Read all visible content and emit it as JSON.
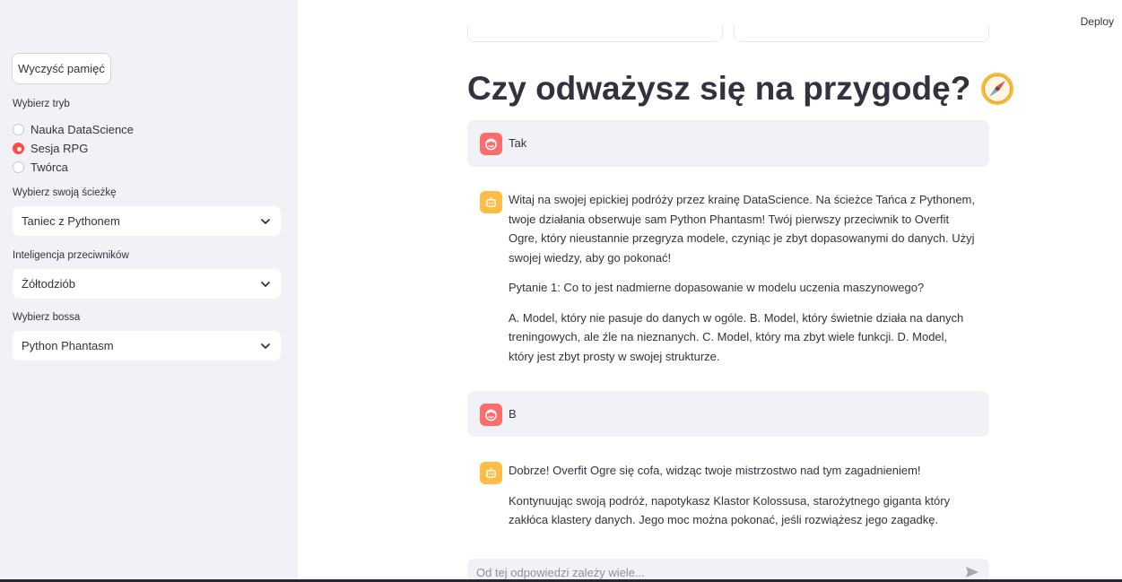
{
  "sidebar": {
    "clear_button": "Wyczyść pamięć",
    "mode_label": "Wybierz tryb",
    "modes": [
      {
        "label": "Nauka DataScience",
        "checked": false
      },
      {
        "label": "Sesja RPG",
        "checked": true
      },
      {
        "label": "Twórca",
        "checked": false
      }
    ],
    "path_label": "Wybierz swoją ścieżkę",
    "path_value": "Taniec z Pythonem",
    "intel_label": "Inteligencja przeciwników",
    "intel_value": "Żółtodziób",
    "boss_label": "Wybierz bossa",
    "boss_value": "Python Phantasm"
  },
  "header": {
    "deploy": "Deploy"
  },
  "main": {
    "title": "Czy odważysz się na przygodę?",
    "messages": [
      {
        "role": "user",
        "text": "Tak"
      },
      {
        "role": "assistant",
        "paragraphs": [
          "Witaj na swojej epickiej podróży przez krainę DataScience. Na ścieżce Tańca z Pythonem, twoje działania obserwuje sam Python Phantasm! Twój pierwszy przeciwnik to Overfit Ogre, który nieustannie przegryza modele, czyniąc je zbyt dopasowanymi do danych. Użyj swojej wiedzy, aby go pokonać!",
          "Pytanie 1: Co to jest nadmierne dopasowanie w modelu uczenia maszynowego?",
          "A. Model, który nie pasuje do danych w ogóle. B. Model, który świetnie działa na danych treningowych, ale źle na nieznanych. C. Model, który ma zbyt wiele funkcji. D. Model, który jest zbyt prosty w swojej strukturze."
        ]
      },
      {
        "role": "user",
        "text": "B"
      },
      {
        "role": "assistant",
        "paragraphs": [
          "Dobrze! Overfit Ogre się cofa, widząc twoje mistrzostwo nad tym zagadnieniem!",
          "Kontynuując swoją podróż, napotykasz Klastor Kolossusa, starożytnego giganta który zakłóca klastery danych. Jego moc można pokonać, jeśli rozwiążesz jego zagadkę."
        ]
      }
    ]
  },
  "chat_input": {
    "placeholder": "Od tej odpowiedzi zależy wiele..."
  },
  "colors": {
    "accent": "#ff4b4b",
    "user_avatar": "#ff6c6c",
    "bot_avatar": "#ffbd45",
    "sidebar_bg": "#f0f2f6"
  }
}
